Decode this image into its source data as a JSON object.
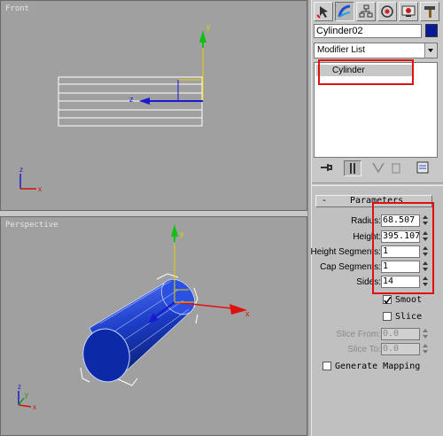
{
  "viewports": {
    "front": {
      "label": "Front"
    },
    "perspective": {
      "label": "Perspective"
    }
  },
  "command_panel": {
    "tabs": [
      {
        "name": "create-tab",
        "icon": "create-icon"
      },
      {
        "name": "modify-tab",
        "icon": "modify-icon"
      },
      {
        "name": "hierarchy-tab",
        "icon": "hierarchy-icon"
      },
      {
        "name": "motion-tab",
        "icon": "motion-icon"
      },
      {
        "name": "display-tab",
        "icon": "display-icon"
      },
      {
        "name": "utilities-tab",
        "icon": "hammer-icon"
      }
    ],
    "object_name": "Cylinder02",
    "object_color": "#0a1a96",
    "modifier_list": "Modifier List",
    "stack_items": [
      "Cylinder"
    ]
  },
  "parameters": {
    "title": "Parameters",
    "collapse": "-",
    "radius_label": "Radius:",
    "radius": "68.507",
    "height_label": "Height:",
    "height": "395.107",
    "height_segments_label": "Height Segments:",
    "height_segments": "1",
    "cap_segments_label": "Cap Segments:",
    "cap_segments": "1",
    "sides_label": "Sides:",
    "sides": "14",
    "smooth_label": "Smoot",
    "smooth_checked": true,
    "slice_label": "Slice",
    "slice_checked": false,
    "slice_from_label": "Slice From:",
    "slice_from": "0.0",
    "slice_to_label": "Slice To:",
    "slice_to": "0.0",
    "gen_mapping_label": "Generate Mapping",
    "gen_mapping_checked": false
  },
  "axis_labels": {
    "x": "x",
    "y": "y",
    "z": "z"
  },
  "colors": {
    "highlight": "#e01010",
    "object": "#0a1a96",
    "viewport_bg": "#a0a0a0"
  }
}
